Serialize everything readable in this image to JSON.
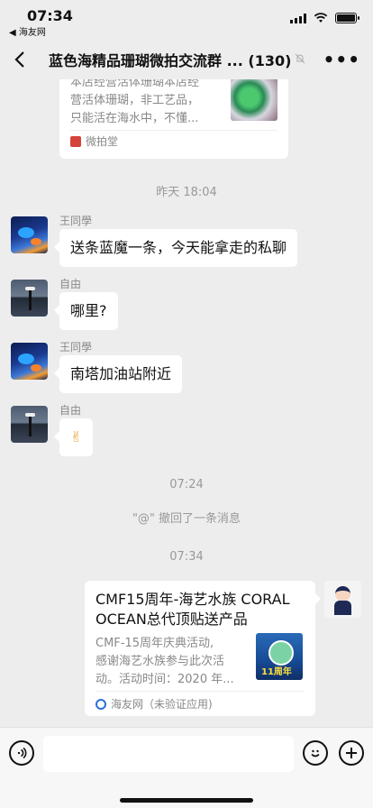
{
  "status": {
    "time": "07:34",
    "back_app": "◀ 海友网"
  },
  "nav": {
    "title": "蓝色海精品珊瑚微拍交流群 ...",
    "count": "(130)"
  },
  "top_card": {
    "desc_lines": [
      "本店经营活体珊瑚本店经",
      "营活体珊瑚，非工艺品，",
      "只能活在海水中，不懂..."
    ],
    "source": "微拍堂"
  },
  "timestamps": [
    "昨天 18:04",
    "07:24",
    "07:34"
  ],
  "messages": [
    {
      "sender": "王同學",
      "text": "送条蓝魔一条，今天能拿走的私聊"
    },
    {
      "sender": "自由",
      "text": "哪里?"
    },
    {
      "sender": "王同學",
      "text": "南塔加油站附近"
    },
    {
      "sender": "自由",
      "text": "✌"
    }
  ],
  "recall_notice": "\"@\" 撤回了一条消息",
  "share_card": {
    "title": "CMF15周年-海艺水族 CORAL OCEAN总代顶贴送产品",
    "desc_lines": [
      "CMF-15周年庆典活动,",
      "感谢海艺水族参与此次活",
      "动。活动时间：2020 年..."
    ],
    "thumb_badge": "11周年",
    "source": "海友网（未验证应用)"
  }
}
